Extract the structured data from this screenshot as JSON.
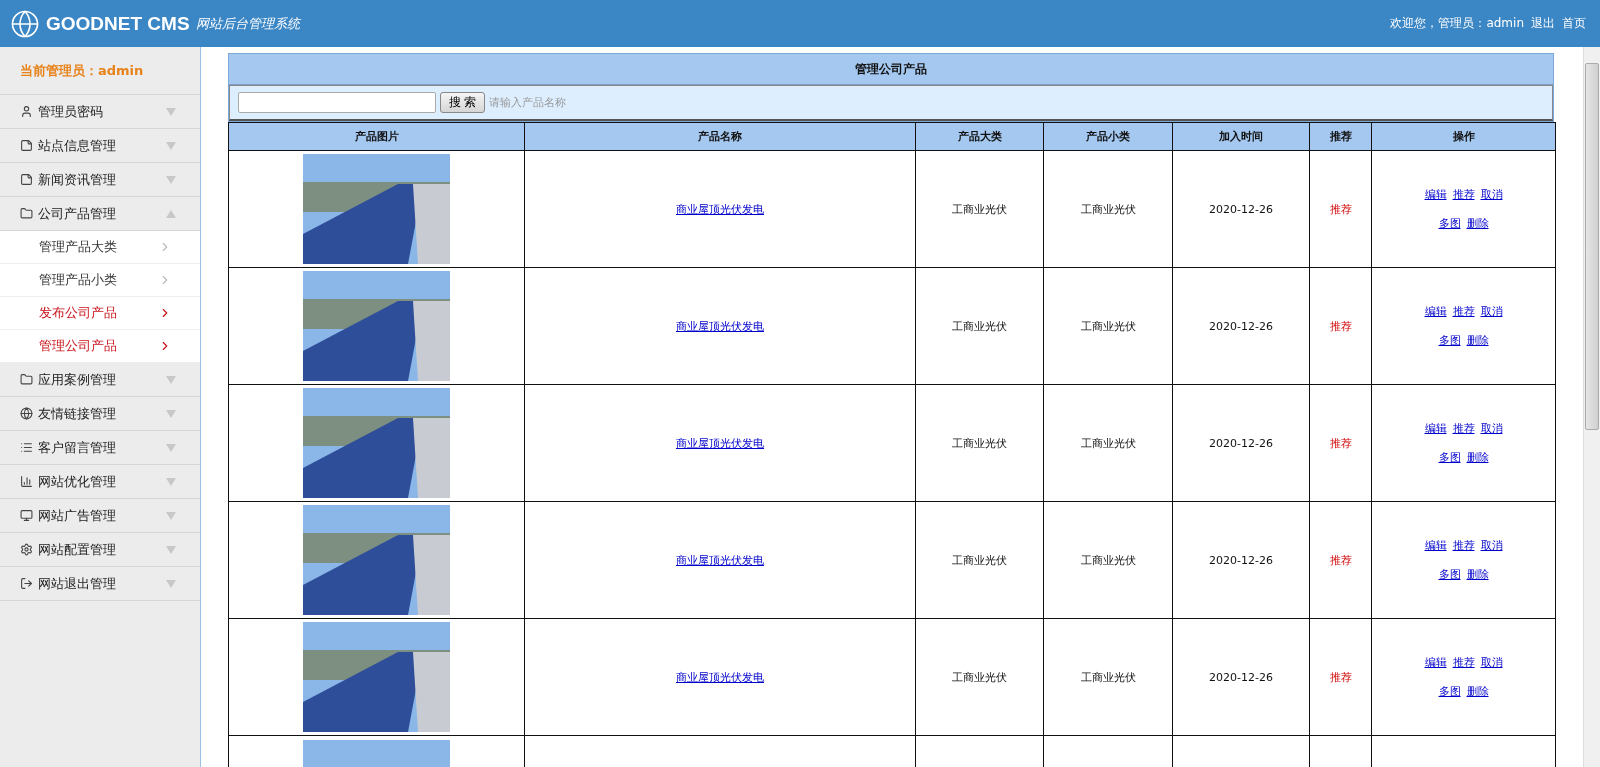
{
  "header": {
    "logo": "GOODNET CMS",
    "subtitle": "网站后台管理系统",
    "welcome": "欢迎您，管理员：admin",
    "links": [
      "退出",
      "首页"
    ]
  },
  "sidebar": {
    "current_admin": "当前管理员：admin",
    "items": [
      {
        "label": "管理员密码",
        "expanded": false
      },
      {
        "label": "站点信息管理",
        "expanded": false
      },
      {
        "label": "新闻资讯管理",
        "expanded": false
      },
      {
        "label": "公司产品管理",
        "expanded": true,
        "children": [
          {
            "label": "管理产品大类",
            "selected": false
          },
          {
            "label": "管理产品小类",
            "selected": false
          },
          {
            "label": "发布公司产品",
            "selected": true
          },
          {
            "label": "管理公司产品",
            "selected": true
          }
        ]
      },
      {
        "label": "应用案例管理",
        "expanded": false
      },
      {
        "label": "友情链接管理",
        "expanded": false
      },
      {
        "label": "客户留言管理",
        "expanded": false
      },
      {
        "label": "网站优化管理",
        "expanded": false
      },
      {
        "label": "网站广告管理",
        "expanded": false
      },
      {
        "label": "网站配置管理",
        "expanded": false
      },
      {
        "label": "网站退出管理",
        "expanded": false
      }
    ]
  },
  "panel": {
    "title": "管理公司产品",
    "search": {
      "button": "搜 索",
      "hint": "请输入产品名称"
    },
    "table": {
      "columns": [
        "产品图片",
        "产品名称",
        "产品大类",
        "产品小类",
        "加入时间",
        "推荐",
        "操作"
      ],
      "rows": [
        {
          "kind": "full",
          "name": "商业屋顶光伏发电",
          "category": "工商业光伏",
          "subcategory": "工商业光伏",
          "date": "2020-12-26",
          "recommend": "推荐",
          "actions": [
            "编辑",
            "推荐",
            "取消",
            "多图",
            "删除"
          ]
        },
        {
          "kind": "full",
          "name": "商业屋顶光伏发电",
          "category": "工商业光伏",
          "subcategory": "工商业光伏",
          "date": "2020-12-26",
          "recommend": "推荐",
          "actions": [
            "编辑",
            "推荐",
            "取消",
            "多图",
            "删除"
          ]
        },
        {
          "kind": "full",
          "name": "商业屋顶光伏发电",
          "category": "工商业光伏",
          "subcategory": "工商业光伏",
          "date": "2020-12-26",
          "recommend": "推荐",
          "actions": [
            "编辑",
            "推荐",
            "取消",
            "多图",
            "删除"
          ]
        },
        {
          "kind": "full",
          "name": "商业屋顶光伏发电",
          "category": "工商业光伏",
          "subcategory": "工商业光伏",
          "date": "2020-12-26",
          "recommend": "推荐",
          "actions": [
            "编辑",
            "推荐",
            "取消",
            "多图",
            "删除"
          ]
        },
        {
          "kind": "full",
          "name": "商业屋顶光伏发电",
          "category": "工商业光伏",
          "subcategory": "工商业光伏",
          "date": "2020-12-26",
          "recommend": "推荐",
          "actions": [
            "编辑",
            "推荐",
            "取消",
            "多图",
            "删除"
          ]
        },
        {
          "kind": "image_only"
        }
      ]
    }
  }
}
